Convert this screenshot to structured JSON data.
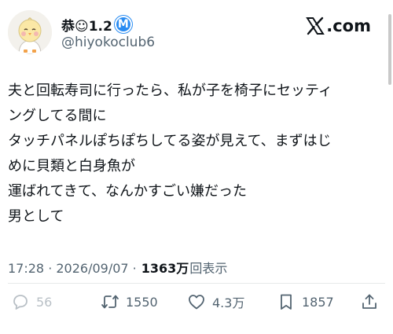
{
  "header": {
    "display_name": "恭☺1.2",
    "badge_letter": "M",
    "handle": "@hiyokoclub6",
    "brand": ".com",
    "brand_icon": "x-logo-icon",
    "avatar_icon": "chick-avatar-icon"
  },
  "tweet": {
    "lines": [
      "夫と回転寿司に行ったら、私が子を椅子にセッティ",
      "ングしてる間に",
      "タッチパネルぽちぽちしてる姿が見えて、まずはじ",
      "めに貝類と白身魚が",
      "運ばれてきて、なんかすごい嫌だった",
      "男として"
    ]
  },
  "meta": {
    "timestamp": "17:28 · 2026/09/07 ·",
    "views_count": "1363万",
    "views_label": "回表示"
  },
  "actions": {
    "reply": {
      "icon": "reply-icon",
      "count": "56"
    },
    "retweet": {
      "icon": "retweet-icon",
      "count": "1550"
    },
    "like": {
      "icon": "heart-icon",
      "count": "4.3万"
    },
    "bookmark": {
      "icon": "bookmark-icon",
      "count": "1857"
    },
    "share": {
      "icon": "share-icon"
    }
  },
  "colors": {
    "text": "#0f1419",
    "secondary": "#536471",
    "badge": "#2a8cf2",
    "divider": "#e7e9ea"
  }
}
